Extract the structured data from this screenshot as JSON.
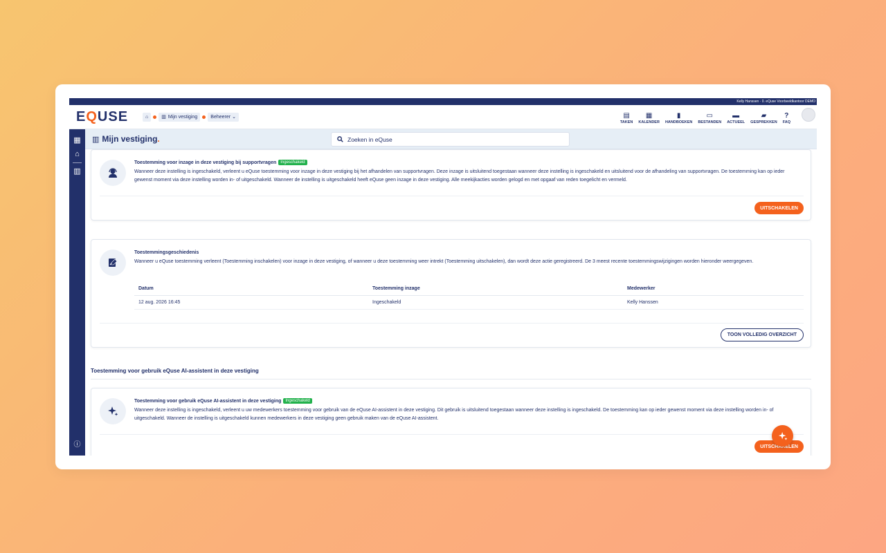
{
  "topstrip": {
    "user": "Kelly Hanssen · 0. eQuse Voorbeeldkantoor DEMO"
  },
  "logo": {
    "part1": "E",
    "part2": "Q",
    "part3": "USE"
  },
  "breadcrumb": [
    {
      "label": "",
      "icon": "home-icon"
    },
    {
      "label": "Mijn vestiging",
      "icon": "building-icon"
    },
    {
      "label": "Beheerer",
      "icon": "chevron-down-icon"
    }
  ],
  "topnav": [
    {
      "label": "TAKEN",
      "icon": "clipboard-icon",
      "glyph": "📋"
    },
    {
      "label": "KALENDER",
      "icon": "calendar-icon",
      "glyph": "📅"
    },
    {
      "label": "HANDBOEKEN",
      "icon": "book-icon",
      "glyph": "📘"
    },
    {
      "label": "BESTANDEN",
      "icon": "archive-icon",
      "glyph": "🗃"
    },
    {
      "label": "ACTUEEL",
      "icon": "news-icon",
      "glyph": "📰"
    },
    {
      "label": "GESPREKKEN",
      "icon": "chat-icon",
      "glyph": "💬"
    },
    {
      "label": "FAQ",
      "icon": "question-icon",
      "glyph": "?"
    }
  ],
  "page": {
    "title": "Mijn vestiging",
    "dot": "."
  },
  "search": {
    "placeholder": "Zoeken in eQuse"
  },
  "card_support": {
    "title": "Toestemming voor inzage in deze vestiging bij supportvragen",
    "badge": "Ingeschakeld",
    "text": "Wanneer deze instelling is ingeschakeld, verleent u eQuse toestemming voor inzage in deze vestiging bij het afhandelen van supportvragen. Deze inzage is uitsluitend toegestaan wanneer deze instelling is ingeschakeld en uitsluitend voor de afhandeling van supportvragen. De toestemming kan op ieder gewenst moment via deze instelling worden in- of uitgeschakeld. Wanneer de instelling is uitgeschakeld heeft eQuse geen inzage in deze vestiging. Alle meekijkacties worden gelogd en met opgaaf van reden toegelicht en vermeld.",
    "button": "UITSCHAKELEN"
  },
  "card_history": {
    "title": "Toestemmingsgeschiedenis",
    "text": "Wanneer u eQuse toestemming verleent (Toestemming inschakelen) voor inzage in deze vestiging, of wanneer u deze toestemming weer intrekt (Toestemming uitschakelen), dan wordt deze actie geregistreerd. De 3 meest recente toestemmingswijzigingen worden hieronder weergegeven.",
    "columns": [
      "Datum",
      "Toestemming inzage",
      "Medewerker"
    ],
    "rows": [
      [
        "12 aug. 2026 16:45",
        "Ingeschakeld",
        "Kelly Hanssen"
      ]
    ],
    "button": "TOON VOLLEDIG OVERZICHT"
  },
  "section_ai": {
    "title": "Toestemming voor gebruik eQuse AI-assistent in deze vestiging"
  },
  "card_ai": {
    "title": "Toestemming voor gebruik eQuse AI-assistent in deze vestiging",
    "badge": "Ingeschakeld",
    "text": "Wanneer deze instelling is ingeschakeld, verleent u uw medewerkers toestemming voor gebruik van de eQuse AI-assistent in deze vestiging. Dit gebruik is uitsluitend toegestaan wanneer deze instelling is ingeschakeld. De toestemming kan op ieder gewenst moment via deze instelling worden in- of uitgeschakeld. Wanneer de instelling is uitgeschakeld kunnen medewerkers in deze vestiging geen gebruik maken van de eQuse AI-assistent.",
    "button": "UITSCHAKELEN"
  },
  "colors": {
    "navy": "#22306a",
    "orange": "#f4611d",
    "green": "#22b14c",
    "titlebar": "#e6eef6"
  }
}
